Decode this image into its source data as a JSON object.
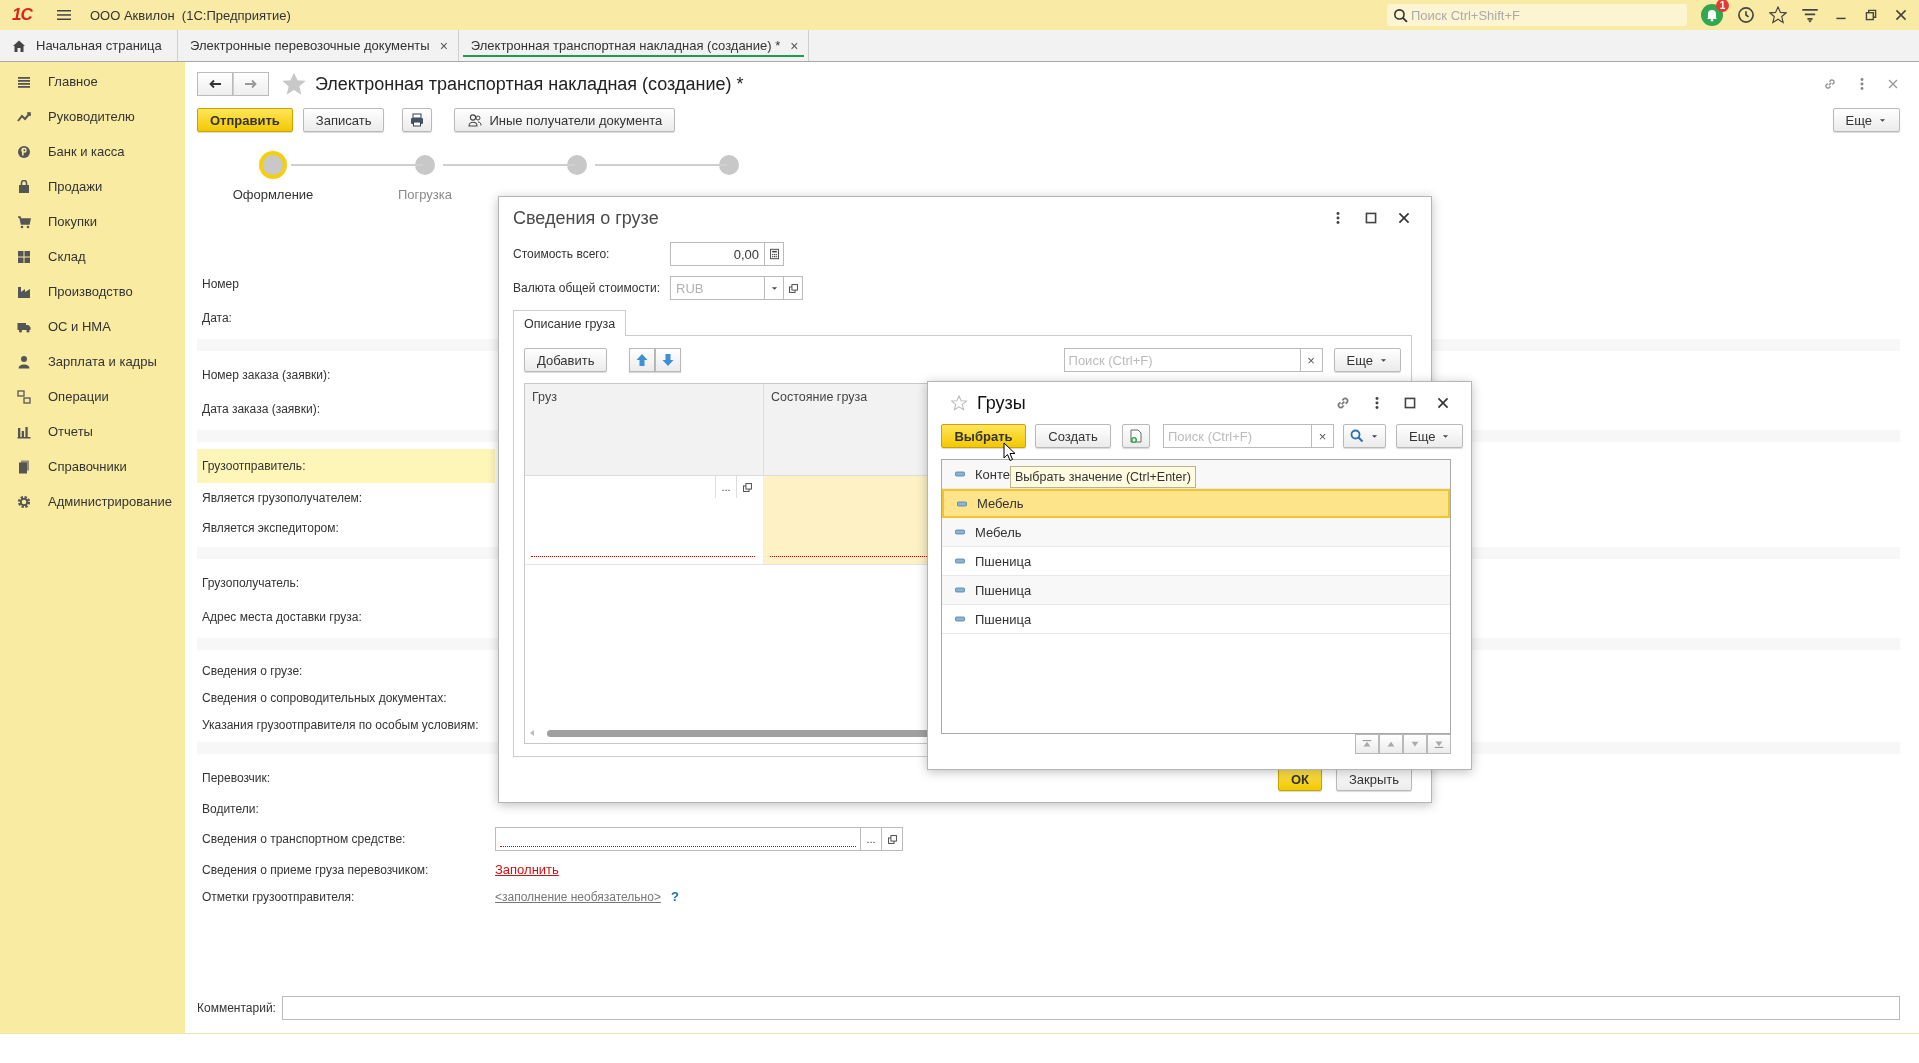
{
  "app_bar": {
    "logo": "1С",
    "title": "ООО Аквилон  (1С:Предприятие)",
    "search": {
      "placeholder": "Поиск Ctrl+Shift+F"
    },
    "notification_count": "1"
  },
  "tabs": [
    {
      "label": "Начальная страница",
      "selected": false,
      "kind": "home"
    },
    {
      "label": "Электронные перевозочные документы",
      "selected": false,
      "kind": "document",
      "close": "×"
    },
    {
      "label": "Электронная транспортная накладная (создание) *",
      "selected": true,
      "kind": "document",
      "close": "×"
    }
  ],
  "sidebar": {
    "items": [
      {
        "label": "Главное"
      },
      {
        "label": "Руководителю"
      },
      {
        "label": "Банк и касса"
      },
      {
        "label": "Продажи"
      },
      {
        "label": "Покупки"
      },
      {
        "label": "Склад"
      },
      {
        "label": "Производство"
      },
      {
        "label": "ОС и НМА"
      },
      {
        "label": "Зарплата и кадры"
      },
      {
        "label": "Операции"
      },
      {
        "label": "Отчеты"
      },
      {
        "label": "Справочники"
      },
      {
        "label": "Администрирование"
      }
    ]
  },
  "document": {
    "title": "Электронная транспортная накладная (создание) *",
    "toolbar": [
      {
        "kind": "primary",
        "label": "Отправить"
      },
      {
        "kind": "default",
        "label": "Записать"
      },
      {
        "kind": "print"
      },
      {
        "kind": "recipients",
        "label": "Иные получатели документа"
      }
    ],
    "more": "Еще",
    "steps": [
      {
        "label": "Оформление",
        "selected": true
      },
      {
        "label": "Погрузка",
        "selected": false
      },
      {
        "selected": false
      },
      {
        "selected": false
      }
    ],
    "groups": [
      {
        "rows": [
          {
            "label": "Номер",
            "kind": "field",
            "selected": false
          },
          {
            "label": "Дата:",
            "kind": "field",
            "selected": false
          }
        ]
      },
      {
        "rows": [
          {
            "label": "Номер заказа (заявки):",
            "kind": "field",
            "selected": false
          },
          {
            "label": "Дата заказа (заявки):",
            "kind": "field",
            "selected": false
          }
        ]
      },
      {
        "rows": [
          {
            "label": "Грузоотправитель:",
            "kind": "field",
            "selected": true
          },
          {
            "label": "Является грузополучателем:",
            "kind": "check",
            "selected": false
          },
          {
            "label": "Является экспедитором:",
            "kind": "check",
            "selected": false
          }
        ]
      },
      {
        "rows": [
          {
            "label": "Грузополучатель:",
            "kind": "field",
            "selected": false
          },
          {
            "label": "Адрес места доставки груза:",
            "kind": "field",
            "selected": false
          }
        ]
      },
      {
        "rows": [
          {
            "label": "Сведения о грузе:",
            "kind": "link",
            "selected": false
          },
          {
            "label": "Сведения о сопроводительных документах:",
            "kind": "link",
            "selected": false
          },
          {
            "label": "Указания грузоотправителя по особым условиям:",
            "kind": "link",
            "selected": false
          }
        ]
      },
      {
        "rows": [
          {
            "label": "Перевозчик:",
            "kind": "field",
            "selected": false
          },
          {
            "label": "Водители:",
            "kind": "link",
            "selected": false
          },
          {
            "label": "Сведения о транспортном средстве:",
            "kind": "field",
            "select_button": "...",
            "selected": false
          },
          {
            "label": "Сведения о приеме груза перевозчиком:",
            "kind": "link",
            "value": "Заполнить",
            "selected": false
          },
          {
            "label": "Отметки грузоотправителя:",
            "kind": "note",
            "value": "<заполнение необязательно>",
            "help": "?",
            "selected": false
          }
        ]
      }
    ],
    "comment": {
      "label": "Комментарий:"
    }
  },
  "cargo_dialog": {
    "title": "Сведения о грузе",
    "total": {
      "label": "Стоимость всего:",
      "value": "0,00"
    },
    "currency": {
      "label": "Валюта общей стоимости:",
      "value": "RUB",
      "disabled": true
    },
    "tabs": [
      {
        "label": "Описание груза",
        "selected": true
      }
    ],
    "add": "Добавить",
    "search": {
      "placeholder": "Поиск (Ctrl+F)",
      "clear": "×"
    },
    "more": "Еще",
    "columns": [
      "Груз",
      "Состояние груза"
    ],
    "rows": [
      {
        "cells": [
          {
            "select_button": "...",
            "selected": false
          },
          {
            "selected": true
          }
        ]
      }
    ],
    "ok": "ОК",
    "close": "Закрыть"
  },
  "cargo_list": {
    "title": "Грузы",
    "choose": "Выбрать",
    "create": "Создать",
    "search": {
      "placeholder": "Поиск (Ctrl+F)",
      "clear": "×"
    },
    "more": "Еще",
    "items": [
      {
        "label": "Конте",
        "selected": false
      },
      {
        "label": "Мебель",
        "selected": true
      },
      {
        "label": "Мебель",
        "selected": false
      },
      {
        "label": "Пшеница",
        "selected": false
      },
      {
        "label": "Пшеница",
        "selected": false
      },
      {
        "label": "Пшеница",
        "selected": false
      }
    ],
    "tooltip": "Выбрать значение (Ctrl+Enter)"
  }
}
